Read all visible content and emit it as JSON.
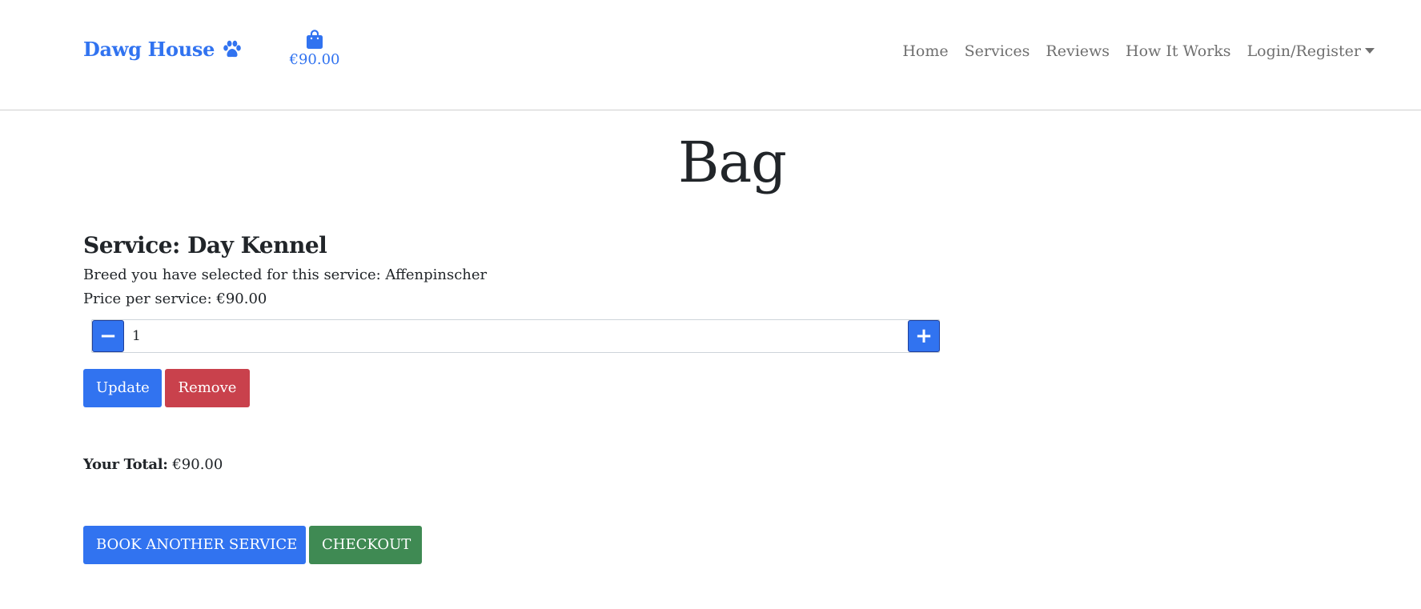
{
  "header": {
    "brand": "Dawg House",
    "bag_amount": "€90.00",
    "nav": {
      "home": "Home",
      "services": "Services",
      "reviews": "Reviews",
      "how_it_works": "How It Works",
      "login": "Login/Register"
    }
  },
  "main": {
    "title": "Bag",
    "service_title": "Service: Day Kennel",
    "breed_line": "Breed you have selected for this service: Affenpinscher",
    "price_line": "Price per service: €90.00",
    "quantity": "1",
    "minus_label": "−",
    "plus_label": "+",
    "update_label": "Update",
    "remove_label": "Remove",
    "total_label": "Your Total:",
    "total_value": " €90.00",
    "book_label": "BOOK ANOTHER SERVICE",
    "checkout_label": "CHECKOUT"
  },
  "colors": {
    "accent": "#3173f0",
    "danger": "#c9414c",
    "success": "#3f8a53",
    "nav_text": "#6f6f6f"
  },
  "icons": {
    "brand": "paw-icon",
    "bag": "shopping-bag-icon",
    "dropdown": "caret-down-icon"
  }
}
